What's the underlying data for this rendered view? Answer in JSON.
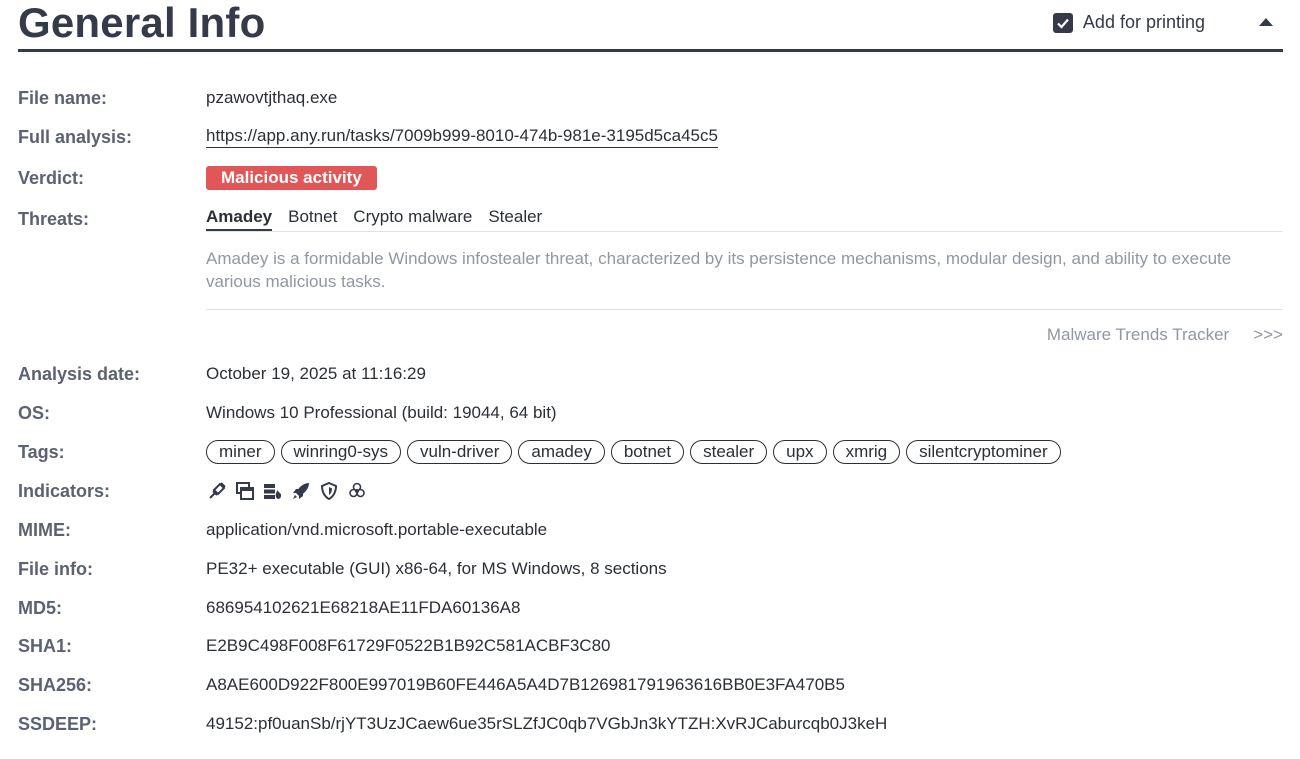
{
  "header": {
    "title": "General Info",
    "print_label": "Add for printing"
  },
  "fields": {
    "file_name": {
      "label": "File name:",
      "value": "pzawovtjthaq.exe"
    },
    "full_analysis": {
      "label": "Full analysis:",
      "value": "https://app.any.run/tasks/7009b999-8010-474b-981e-3195d5ca45c5"
    },
    "verdict": {
      "label": "Verdict:",
      "value": "Malicious activity"
    },
    "threats": {
      "label": "Threats:",
      "tabs": [
        "Amadey",
        "Botnet",
        "Crypto malware",
        "Stealer"
      ],
      "description": "Amadey is a formidable Windows infostealer threat, characterized by its persistence mechanisms, modular design, and ability to execute various malicious tasks.",
      "tracker": "Malware Trends Tracker",
      "tracker_arrow": ">>>"
    },
    "analysis_date": {
      "label": "Analysis date:",
      "value": "October 19, 2025 at 11:16:29"
    },
    "os": {
      "label": "OS:",
      "value": "Windows 10 Professional (build: 19044, 64 bit)"
    },
    "tags": {
      "label": "Tags:",
      "items": [
        "miner",
        "winring0-sys",
        "vuln-driver",
        "amadey",
        "botnet",
        "stealer",
        "upx",
        "xmrig",
        "silentcryptominer"
      ]
    },
    "indicators": {
      "label": "Indicators:",
      "icons": [
        "syringe-icon",
        "windows-icon",
        "server-fire-icon",
        "rocket-icon",
        "shield-icon",
        "biohazard-icon"
      ]
    },
    "mime": {
      "label": "MIME:",
      "value": "application/vnd.microsoft.portable-executable"
    },
    "file_info": {
      "label": "File info:",
      "value": "PE32+ executable (GUI) x86-64, for MS Windows, 8 sections"
    },
    "md5": {
      "label": "MD5:",
      "value": "686954102621E68218AE11FDA60136A8"
    },
    "sha1": {
      "label": "SHA1:",
      "value": "E2B9C498F008F61729F0522B1B92C581ACBF3C80"
    },
    "sha256": {
      "label": "SHA256:",
      "value": "A8AE600D922F800E997019B60FE446A5A4D7B126981791963616BB0E3FA470B5"
    },
    "ssdeep": {
      "label": "SSDEEP:",
      "value": "49152:pf0uanSb/rjYT3UzJCaew6ue35rSLZfJC0qb7VGbJn3kYTZH:XvRJCaburcqb0J3keH"
    }
  },
  "colors": {
    "accent": "#343a48",
    "verdict": "#e15656",
    "muted": "#9097a2"
  }
}
